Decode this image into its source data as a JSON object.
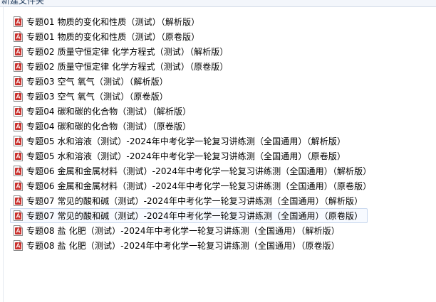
{
  "folder": {
    "title": "新建文件夹"
  },
  "icons": {
    "file_icon": "pdf-file-icon",
    "icon_color": "#c9302c"
  },
  "files": [
    {
      "name": "专题01 物质的变化和性质（测试）（解析版）"
    },
    {
      "name": "专题01 物质的变化和性质（测试）（原卷版）"
    },
    {
      "name": "专题02  质量守恒定律 化学方程式（测试）（解析版）"
    },
    {
      "name": "专题02  质量守恒定律 化学方程式（测试）（原卷版）"
    },
    {
      "name": "专题03 空气  氧气（测试）（解析版）"
    },
    {
      "name": "专题03 空气  氧气（测试）（原卷版）"
    },
    {
      "name": "专题04 碳和碳的化合物（测试）（解析版）"
    },
    {
      "name": "专题04 碳和碳的化合物（测试）（原卷版）"
    },
    {
      "name": "专题05 水和溶液（测试）-2024年中考化学一轮复习讲练测（全国通用）（解析版）"
    },
    {
      "name": "专题05 水和溶液（测试）-2024年中考化学一轮复习讲练测（全国通用）（原卷版）"
    },
    {
      "name": "专题06 金属和金属材料（测试）-2024年中考化学一轮复习讲练测（全国通用）（解析版）"
    },
    {
      "name": "专题06 金属和金属材料（测试）-2024年中考化学一轮复习讲练测（全国通用）（原卷版）"
    },
    {
      "name": "专题07 常见的酸和碱（测试）-2024年中考化学一轮复习讲练测（全国通用）（解析版）"
    },
    {
      "name": "专题07 常见的酸和碱（测试）-2024年中考化学一轮复习讲练测（全国通用）（原卷版）"
    },
    {
      "name": "专题08 盐 化肥（测试）-2024年中考化学一轮复习讲练测（全国通用）（解析版）"
    },
    {
      "name": "专题08 盐 化肥（测试）-2024年中考化学一轮复习讲练测（全国通用）（原卷版）"
    }
  ],
  "focused_index": 13
}
